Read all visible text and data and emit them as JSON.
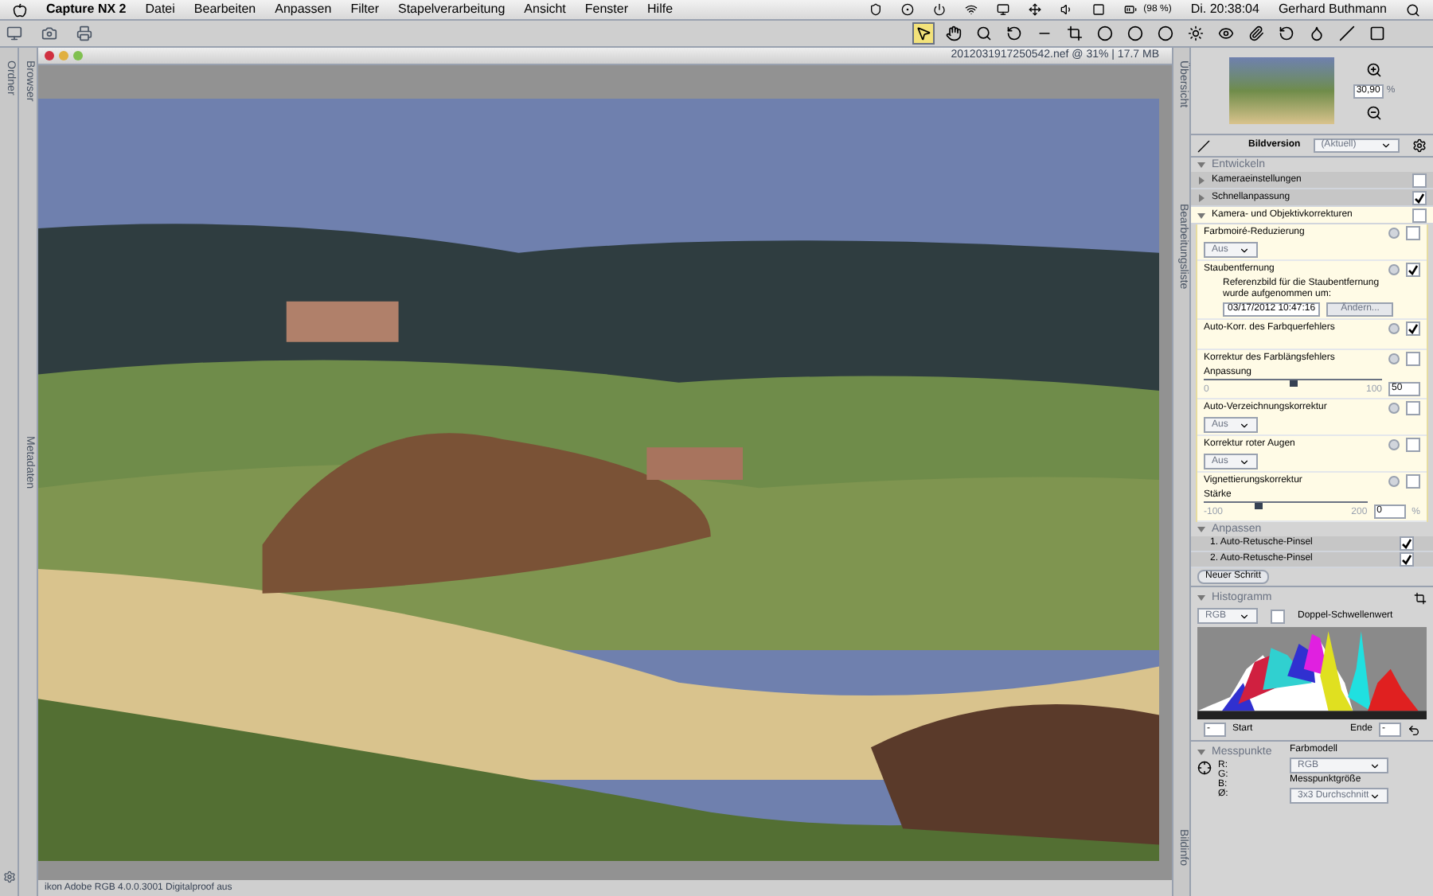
{
  "menu_bar": {
    "app": "Capture NX 2",
    "menus": [
      "Datei",
      "Bearbeiten",
      "Anpassen",
      "Filter",
      "Stapelverarbeitung",
      "Ansicht",
      "Fenster",
      "Hilfe"
    ],
    "battery": "(98 %)",
    "clock": "Di. 20:38:04",
    "user": "Gerhard Buthmann"
  },
  "toolbar": {
    "tools": [
      {
        "selected": true
      },
      {
        "selected": false
      },
      {
        "selected": false
      },
      {
        "selected": false
      },
      {
        "selected": false
      },
      {
        "selected": false
      },
      {
        "selected": false
      },
      {
        "selected": false
      },
      {
        "selected": false
      },
      {
        "selected": false
      },
      {
        "selected": false
      },
      {
        "selected": false
      },
      {
        "selected": false
      },
      {
        "selected": false
      },
      {
        "selected": false
      },
      {
        "selected": false
      }
    ]
  },
  "left_tabs": [
    "Ordner",
    "Browser",
    "Metadaten"
  ],
  "document": {
    "title": "2012031917250542.nef @ 31% | 17.7 MB",
    "status": "ikon Adobe RGB 4.0.0.3001 Digitalproof aus"
  },
  "right_tabs": [
    "Übersicht",
    "Bearbeitungsliste",
    "Bildinfo"
  ],
  "overview": {
    "zoom": "30,90",
    "unit": "%"
  },
  "version": {
    "label": "Bildversion",
    "value": "(Aktuell)"
  },
  "develop": {
    "title": "Entwickeln",
    "steps": [
      {
        "label": "Kameraeinstellungen",
        "expanded": false,
        "checked": false
      },
      {
        "label": "Schnellanpassung",
        "expanded": false,
        "checked": true
      },
      {
        "label": "Kamera- und Objektivkorrekturen",
        "expanded": true,
        "checked": false
      }
    ],
    "corrections": [
      {
        "kind": "dropdown",
        "label": "Farbmoiré-Reduzierung",
        "checked": false,
        "value": "Aus"
      },
      {
        "kind": "dust",
        "label": "Staubentfernung",
        "checked": true,
        "text": "Referenzbild für die Staubentfernung wurde aufgenommen um:",
        "date": "03/17/2012 10:47:16",
        "button": "Ändern..."
      },
      {
        "kind": "plain",
        "label": "Auto-Korr. des Farbquerfehlers",
        "checked": true
      },
      {
        "kind": "slider",
        "label": "Korrektur des Farblängsfehlers",
        "checked": false,
        "slider_label": "Anpassung",
        "min": "0",
        "max": "100",
        "value": "50",
        "level": 0.5
      },
      {
        "kind": "dropdown",
        "label": "Auto-Verzeichnungskorrektur",
        "checked": false,
        "value": "Aus"
      },
      {
        "kind": "dropdown",
        "label": "Korrektur roter Augen",
        "checked": false,
        "value": "Aus"
      },
      {
        "kind": "slider",
        "label": "Vignettierungskorrektur",
        "checked": false,
        "slider_label": "Stärke",
        "min": "-100",
        "max": "200",
        "value": "0",
        "unit": "%",
        "level": 0.33
      }
    ]
  },
  "adjust": {
    "title": "Anpassen",
    "steps": [
      {
        "label": "1. Auto-Retusche-Pinsel",
        "checked": true
      },
      {
        "label": "2. Auto-Retusche-Pinsel",
        "checked": true
      }
    ],
    "button": "Neuer Schritt"
  },
  "histogram": {
    "title": "Histogramm",
    "channel": "RGB",
    "double_threshold": {
      "label": "Doppel-Schwellenwert",
      "checked": false
    },
    "start_label": "Start",
    "start": "-",
    "end_label": "Ende",
    "end": "-"
  },
  "measure": {
    "title": "Messpunkte",
    "channels": [
      "R:",
      "G:",
      "B:",
      "Ø:"
    ],
    "model_label": "Farbmodell",
    "model": "RGB",
    "size_label": "Messpunktgröße",
    "size": "3x3 Durchschnitt"
  }
}
